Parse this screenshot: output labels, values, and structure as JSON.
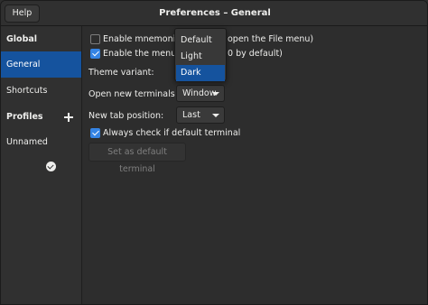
{
  "header": {
    "title": "Preferences – General",
    "help_label": "Help"
  },
  "sidebar": {
    "global_heading": "Global",
    "items": [
      {
        "label": "General",
        "active": true
      },
      {
        "label": "Shortcuts",
        "active": false
      }
    ],
    "profiles_heading": "Profiles",
    "profiles": [
      {
        "label": "Unnamed",
        "default": true
      }
    ]
  },
  "general": {
    "mnemonics_label": "Enable mnemonics (s",
    "mnemonics_label_tail": "open the File menu)",
    "mnemonics_checked": false,
    "menu_accel_label": "Enable the menu acce",
    "menu_accel_label_tail": "0 by default)",
    "menu_accel_checked": true,
    "theme_label": "Theme variant:",
    "new_terminals_label": "Open new terminals in:",
    "new_terminals_value": "Window",
    "new_tab_label": "New tab position:",
    "new_tab_value": "Last",
    "check_default_label": "Always check if default terminal",
    "check_default_checked": true,
    "set_default_button": "Set as default terminal"
  },
  "theme_popover": {
    "options": [
      "Default",
      "Light",
      "Dark"
    ],
    "selected": "Dark"
  },
  "colors": {
    "accent": "#15539e",
    "checkbox": "#3584e4",
    "background": "#2d2d2d"
  }
}
